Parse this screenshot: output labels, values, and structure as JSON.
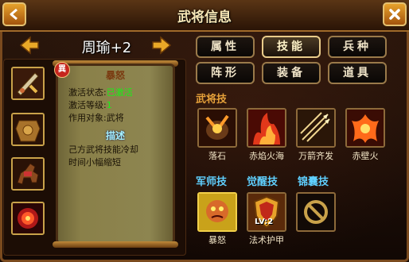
{
  "window": {
    "title": "武将信息"
  },
  "hero": {
    "name": "周瑜",
    "level": "+2"
  },
  "skill_detail": {
    "badge": "異",
    "name": "暴怒",
    "status_label": "激活状态:",
    "status_value": "已激活",
    "level_label": "激活等级:",
    "level_value": "1",
    "target_label": "作用对象:",
    "target_value": "武将",
    "desc_title": "描述",
    "desc_line1": "己方武将技能冷却",
    "desc_line2": "时间小幅缩短"
  },
  "tabs": [
    "属性",
    "技能",
    "兵种",
    "阵形",
    "装备",
    "道具"
  ],
  "active_tab": "技能",
  "general_skills": {
    "title": "武将技",
    "items": [
      "落石",
      "赤焰火海",
      "万箭齐发",
      "赤壁火"
    ]
  },
  "other_sections": {
    "strategist_title": "军师技",
    "awaken_title": "觉醒技",
    "tips_title": "锦囊技",
    "strategist_skill": "暴怒",
    "awaken_skill": "法术护甲",
    "awaken_level": "LV:2"
  },
  "colors": {
    "gold_title": "#e7a23a",
    "blue_title": "#5fd0ff",
    "active_green": "#16f016"
  }
}
